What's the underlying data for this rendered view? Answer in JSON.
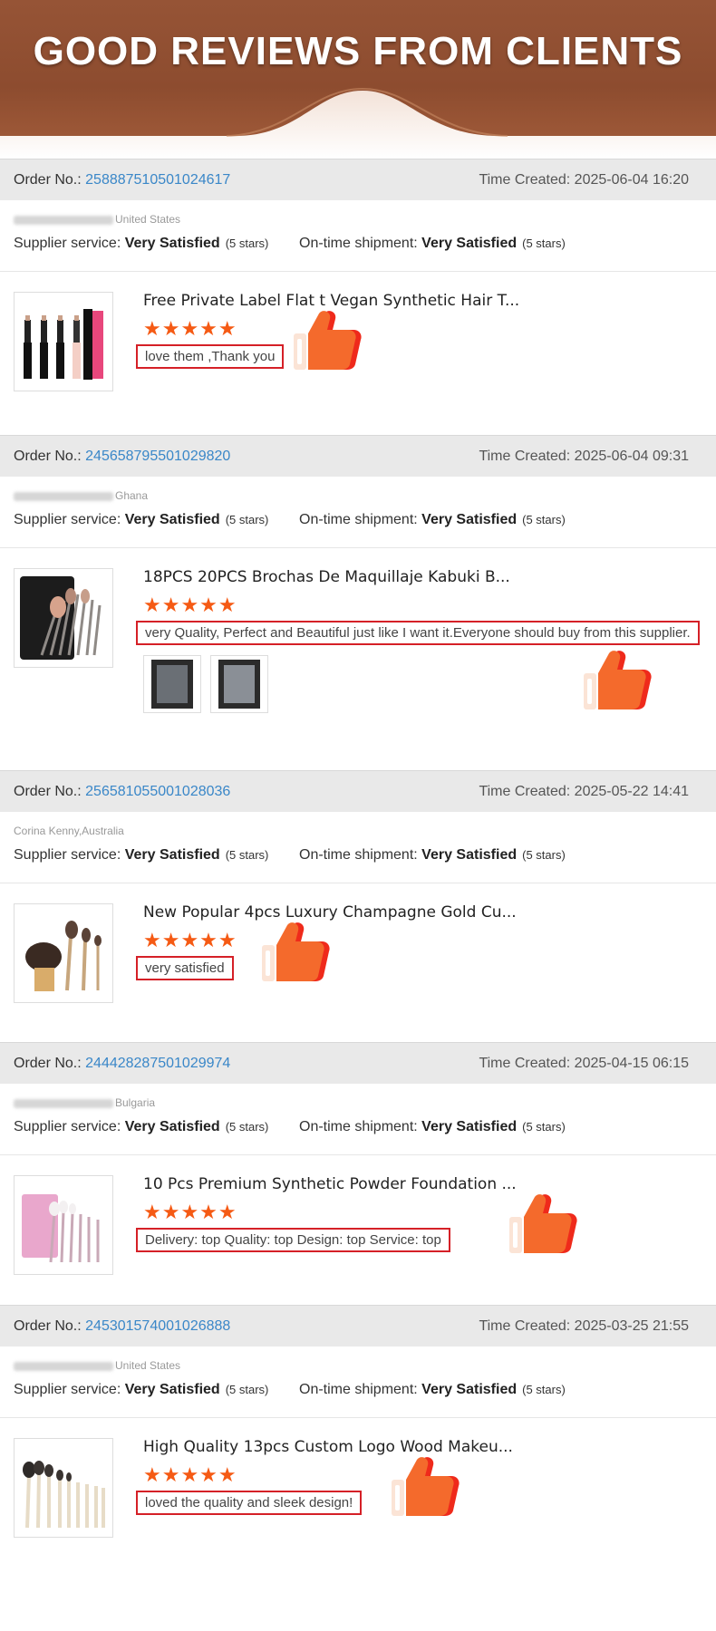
{
  "banner": {
    "title": "GOOD REVIEWS FROM CLIENTS"
  },
  "labels": {
    "order_no": "Order No.:",
    "time_created": "Time Created:",
    "supplier_service": "Supplier service:",
    "ontime_shipment": "On-time shipment:"
  },
  "colors": {
    "banner": "#965436",
    "order_link": "#3a87c8",
    "stars": "#f55a14",
    "comment_border": "#d52027"
  },
  "reviews": [
    {
      "order_number": "258887510501024617",
      "time_created": "2025-06-04 16:20",
      "buyer_country": "United States",
      "supplier_service": "Very Satisfied",
      "supplier_stars": "(5 stars)",
      "shipment": "Very Satisfied",
      "shipment_stars": "(5 stars)",
      "product_title": "Free Private Label Flat t Vegan Synthetic Hair T...",
      "stars": "★★★★★",
      "comment": "love them ,Thank you"
    },
    {
      "order_number": "245658795501029820",
      "time_created": "2025-06-04 09:31",
      "buyer_country": "Ghana",
      "supplier_service": "Very Satisfied",
      "supplier_stars": "(5 stars)",
      "shipment": "Very Satisfied",
      "shipment_stars": "(5 stars)",
      "product_title": "18PCS 20PCS Brochas De Maquillaje Kabuki B...",
      "stars": "★★★★★",
      "comment": "very Quality, Perfect and Beautiful just like I want it.Everyone should buy from this supplier."
    },
    {
      "order_number": "256581055001028036",
      "time_created": "2025-05-22 14:41",
      "buyer": "Corina Kenny,Australia",
      "supplier_service": "Very Satisfied",
      "supplier_stars": "(5 stars)",
      "shipment": "Very Satisfied",
      "shipment_stars": "(5 stars)",
      "product_title": "New Popular 4pcs Luxury Champagne Gold Cu...",
      "stars": "★★★★★",
      "comment": "very satisfied"
    },
    {
      "order_number": "244428287501029974",
      "time_created": "2025-04-15 06:15",
      "buyer_country": "Bulgaria",
      "supplier_service": "Very Satisfied",
      "supplier_stars": "(5 stars)",
      "shipment": "Very Satisfied",
      "shipment_stars": "(5 stars)",
      "product_title": "10 Pcs Premium Synthetic Powder Foundation ...",
      "stars": "★★★★★",
      "comment": "Delivery:  top Quality:  top Design:  top Service:  top"
    },
    {
      "order_number": "245301574001026888",
      "time_created": "2025-03-25 21:55",
      "buyer_country": "United States",
      "supplier_service": "Very Satisfied",
      "supplier_stars": "(5 stars)",
      "shipment": "Very Satisfied",
      "shipment_stars": "(5 stars)",
      "product_title": "High Quality 13pcs Custom Logo Wood Makeu...",
      "stars": "★★★★★",
      "comment": "loved the quality and sleek design!"
    }
  ]
}
